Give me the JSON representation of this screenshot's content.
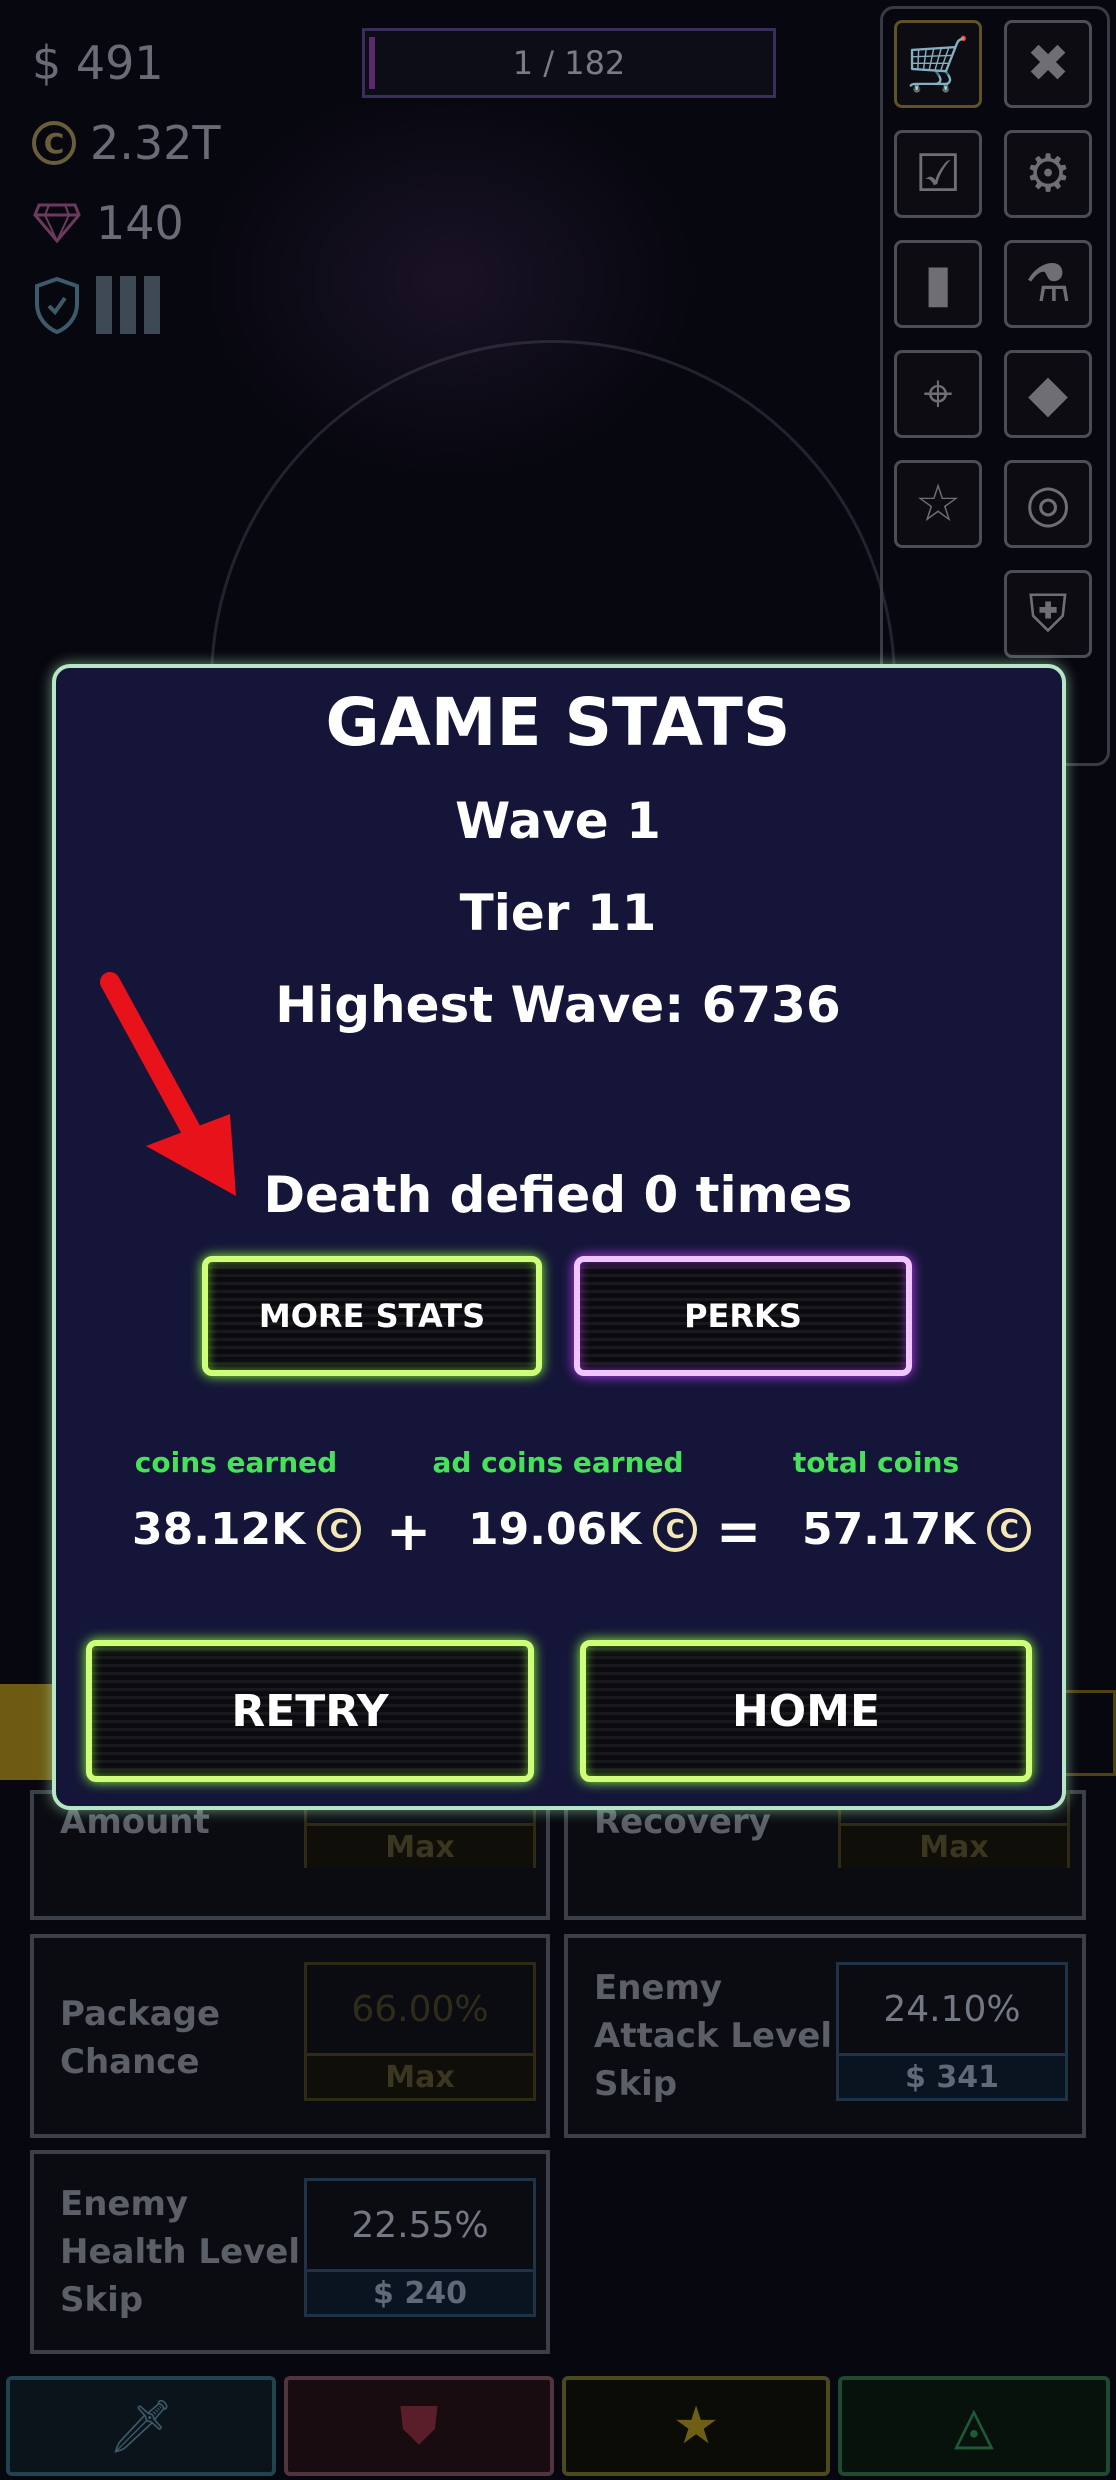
{
  "hud": {
    "cash": "$ 491",
    "coins": "2.32T",
    "gems": "140",
    "wave_progress": "1 / 182"
  },
  "side_menu": {
    "icons": [
      "cart-icon",
      "close-icon",
      "checklist-icon",
      "gear-icon",
      "card-icon",
      "flask-icon",
      "target-icon",
      "diamond-icon",
      "star-icon",
      "radar-icon",
      "banner-icon"
    ]
  },
  "upgrades": [
    {
      "name": "Amount",
      "value": "",
      "cost": "Max"
    },
    {
      "name": "Recovery",
      "value": "",
      "cost": "Max"
    },
    {
      "name": "Package\nChance",
      "value": "66.00%",
      "cost": "Max"
    },
    {
      "name": "Enemy\nAttack Level\nSkip",
      "value": "24.10%",
      "cost": "$ 341"
    },
    {
      "name": "Enemy\nHealth Level\nSkip",
      "value": "22.55%",
      "cost": "$ 240"
    }
  ],
  "dialog": {
    "title": "GAME STATS",
    "wave": "Wave 1",
    "tier": "Tier 11",
    "highest_wave": "Highest Wave: 6736",
    "death_defied": "Death defied 0 times",
    "more_stats_label": "MORE STATS",
    "perks_label": "PERKS",
    "coins_earned_label": "coins earned",
    "ad_coins_earned_label": "ad coins earned",
    "total_coins_label": "total coins",
    "coins_earned": "38.12K",
    "ad_coins_earned": "19.06K",
    "total_coins": "57.17K",
    "plus": "+",
    "equals": "=",
    "retry_label": "RETRY",
    "home_label": "HOME"
  },
  "colors": {
    "dialog_bg": "#141538",
    "green_accent": "#cfff7a",
    "purple_accent": "#f1c6ff",
    "label_green": "#46e25a",
    "annotation_arrow": "#e8121a"
  }
}
